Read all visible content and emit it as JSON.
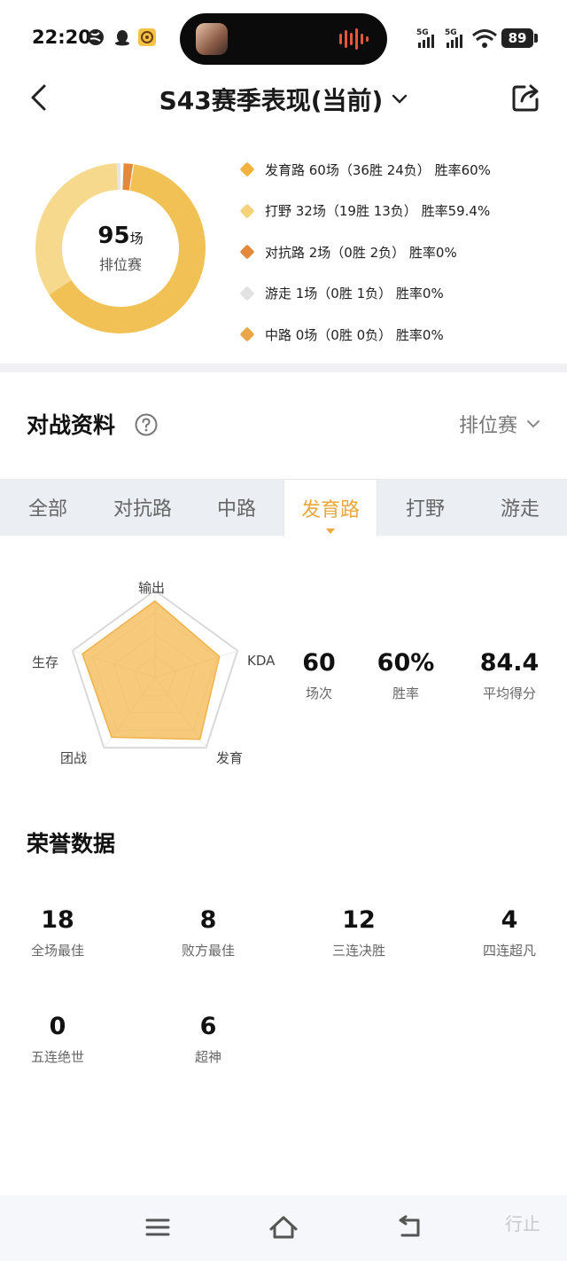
{
  "status_bar": {
    "time": "22:20",
    "signal_1": "5G",
    "signal_2": "5G",
    "battery": "89"
  },
  "header": {
    "title": "S43赛季表现(当前)"
  },
  "summary": {
    "total_count": "95",
    "total_unit": "场",
    "total_label": "排位赛",
    "legend": [
      {
        "text": "发育路 60场（36胜 24负） 胜率60%",
        "color": "#f2b23c"
      },
      {
        "text": "打野 32场（19胜 13负） 胜率59.4%",
        "color": "#f6d37a"
      },
      {
        "text": "对抗路 2场（0胜 2负） 胜率0%",
        "color": "#e4893a"
      },
      {
        "text": "游走 1场（0胜 1负） 胜率0%",
        "color": "#e2e2e2"
      },
      {
        "text": "中路 0场（0胜 0负） 胜率0%",
        "color": "#eaa548"
      }
    ]
  },
  "battle": {
    "title": "对战资料",
    "mode": "排位赛",
    "tabs": [
      "全部",
      "对抗路",
      "中路",
      "发育路",
      "打野",
      "游走"
    ],
    "active_tab": 3
  },
  "radar": {
    "labels": [
      "输出",
      "KDA",
      "发育",
      "团战",
      "生存"
    ],
    "values": [
      0.88,
      0.78,
      0.88,
      0.85,
      0.88
    ]
  },
  "stats": [
    {
      "value": "60",
      "label": "场次"
    },
    {
      "value": "60%",
      "label": "胜率"
    },
    {
      "value": "84.4",
      "label": "平均得分"
    }
  ],
  "honor": {
    "title": "荣誉数据",
    "items": [
      {
        "value": "18",
        "label": "全场最佳"
      },
      {
        "value": "8",
        "label": "败方最佳"
      },
      {
        "value": "12",
        "label": "三连决胜"
      },
      {
        "value": "4",
        "label": "四连超凡"
      },
      {
        "value": "0",
        "label": "五连绝世"
      },
      {
        "value": "6",
        "label": "超神"
      }
    ]
  },
  "nav": {
    "watermark": "行止"
  }
}
